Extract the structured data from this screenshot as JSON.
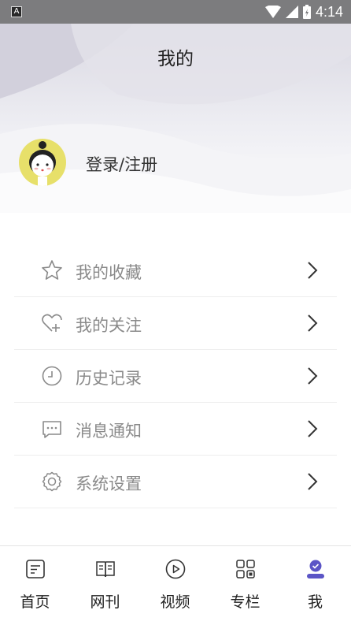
{
  "status_bar": {
    "app_icon_letter": "A",
    "time": "4:14"
  },
  "header": {
    "title": "我的",
    "login_label": "登录/注册"
  },
  "menu": [
    {
      "label": "我的收藏",
      "icon": "star-icon"
    },
    {
      "label": "我的关注",
      "icon": "heart-plus-icon"
    },
    {
      "label": "历史记录",
      "icon": "clock-icon"
    },
    {
      "label": "消息通知",
      "icon": "message-icon"
    },
    {
      "label": "系统设置",
      "icon": "gear-icon"
    }
  ],
  "tabs": [
    {
      "label": "首页",
      "icon": "home-doc-icon",
      "active": false
    },
    {
      "label": "网刊",
      "icon": "book-icon",
      "active": false
    },
    {
      "label": "视频",
      "icon": "play-icon",
      "active": false
    },
    {
      "label": "专栏",
      "icon": "grid-icon",
      "active": false
    },
    {
      "label": "我",
      "icon": "user-icon",
      "active": true
    }
  ],
  "colors": {
    "accent": "#5b55c6",
    "menu_text": "#8a8a8a",
    "avatar_bg": "#e7e06a"
  }
}
